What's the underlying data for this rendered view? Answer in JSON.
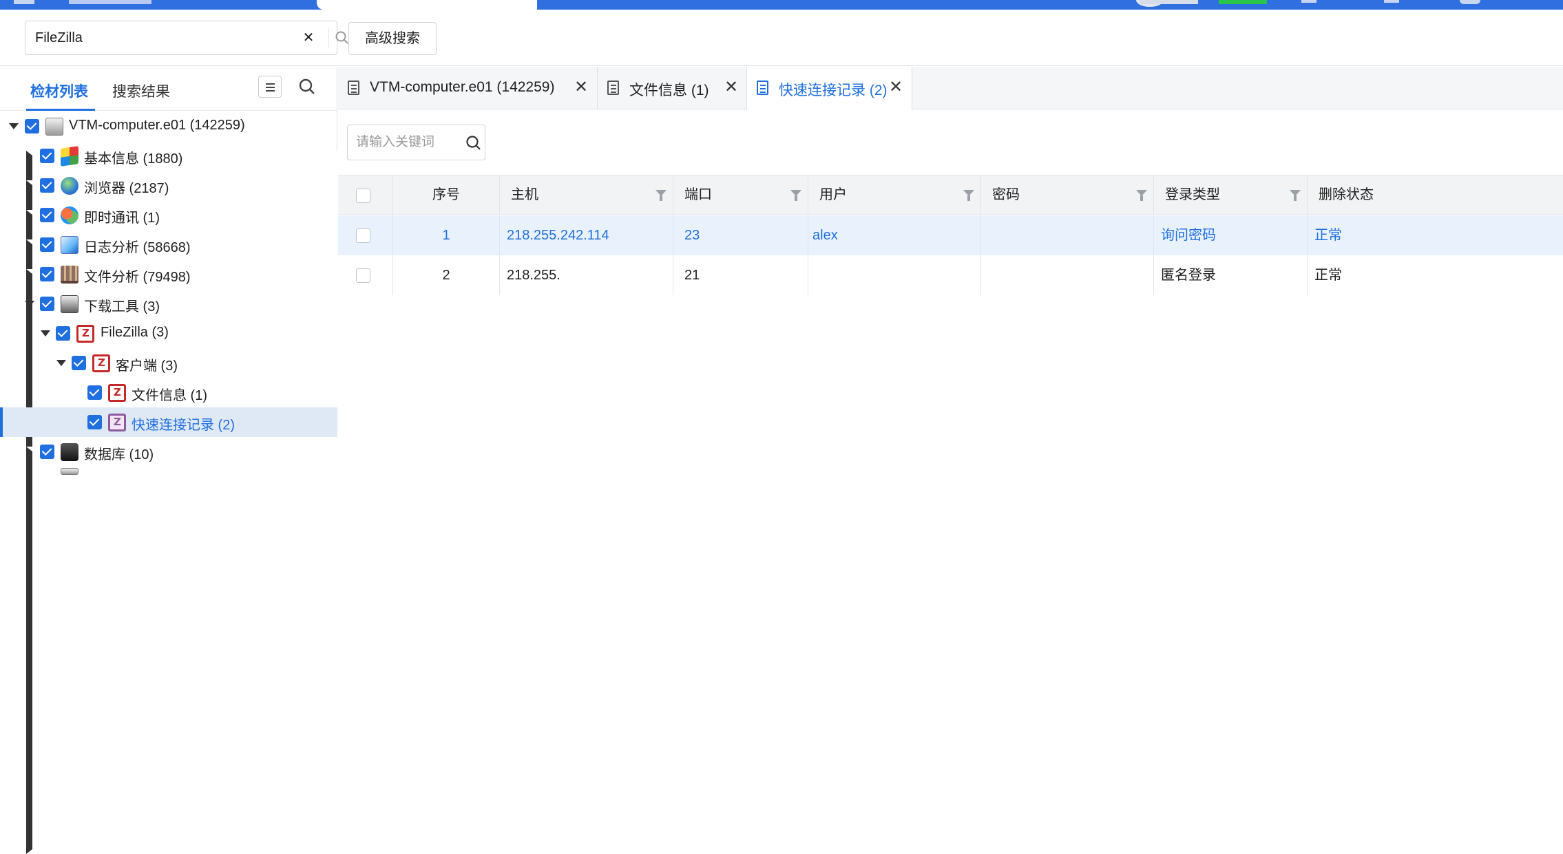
{
  "search": {
    "value": "FileZilla",
    "clear_icon": "close-icon",
    "search_icon": "search-icon"
  },
  "advanced_search_label": "高级搜索",
  "left_panel": {
    "tabs": [
      {
        "label": "检材列表",
        "active": true
      },
      {
        "label": "搜索结果",
        "active": false
      }
    ],
    "tree": [
      {
        "label": "VTM-computer.e01 (142259)",
        "level": 0,
        "expanded": true,
        "icon": "computer-icon"
      },
      {
        "label": "基本信息 (1880)",
        "level": 1,
        "expanded": false,
        "icon": "windows-icon"
      },
      {
        "label": "浏览器 (2187)",
        "level": 1,
        "expanded": false,
        "icon": "globe-icon"
      },
      {
        "label": "即时通讯 (1)",
        "level": 1,
        "expanded": false,
        "icon": "chat-icon"
      },
      {
        "label": "日志分析 (58668)",
        "level": 1,
        "expanded": false,
        "icon": "log-icon"
      },
      {
        "label": "文件分析 (79498)",
        "level": 1,
        "expanded": false,
        "icon": "files-icon"
      },
      {
        "label": "下载工具 (3)",
        "level": 1,
        "expanded": true,
        "icon": "download-tool-icon"
      },
      {
        "label": "FileZilla (3)",
        "level": 2,
        "expanded": true,
        "icon": "filezilla-icon"
      },
      {
        "label": "客户端 (3)",
        "level": 3,
        "expanded": true,
        "icon": "filezilla-icon"
      },
      {
        "label": "文件信息 (1)",
        "level": 4,
        "icon": "filezilla-icon"
      },
      {
        "label": "快速连接记录 (2)",
        "level": 4,
        "icon": "filezilla-icon",
        "selected": true
      },
      {
        "label": "数据库 (10)",
        "level": 1,
        "expanded": false,
        "icon": "database-icon"
      }
    ]
  },
  "content_tabs": [
    {
      "label": "VTM-computer.e01 (142259)",
      "active": false
    },
    {
      "label": "文件信息 (1)",
      "active": false
    },
    {
      "label": "快速连接记录 (2)",
      "active": true
    }
  ],
  "keyword_search": {
    "placeholder": "请输入关键词"
  },
  "table": {
    "columns": [
      "序号",
      "主机",
      "端口",
      "用户",
      "密码",
      "登录类型",
      "删除状态"
    ],
    "rows": [
      [
        "1",
        "218.255.242.114",
        "23",
        "alex",
        "",
        "询问密码",
        "正常"
      ],
      [
        "2",
        "218.255.",
        "21",
        "",
        "",
        "匿名登录",
        "正常"
      ]
    ]
  },
  "colors": {
    "accent": "#1f6fe0",
    "selected_row": "#e9f1fd",
    "header_bg": "#f2f3f5"
  }
}
